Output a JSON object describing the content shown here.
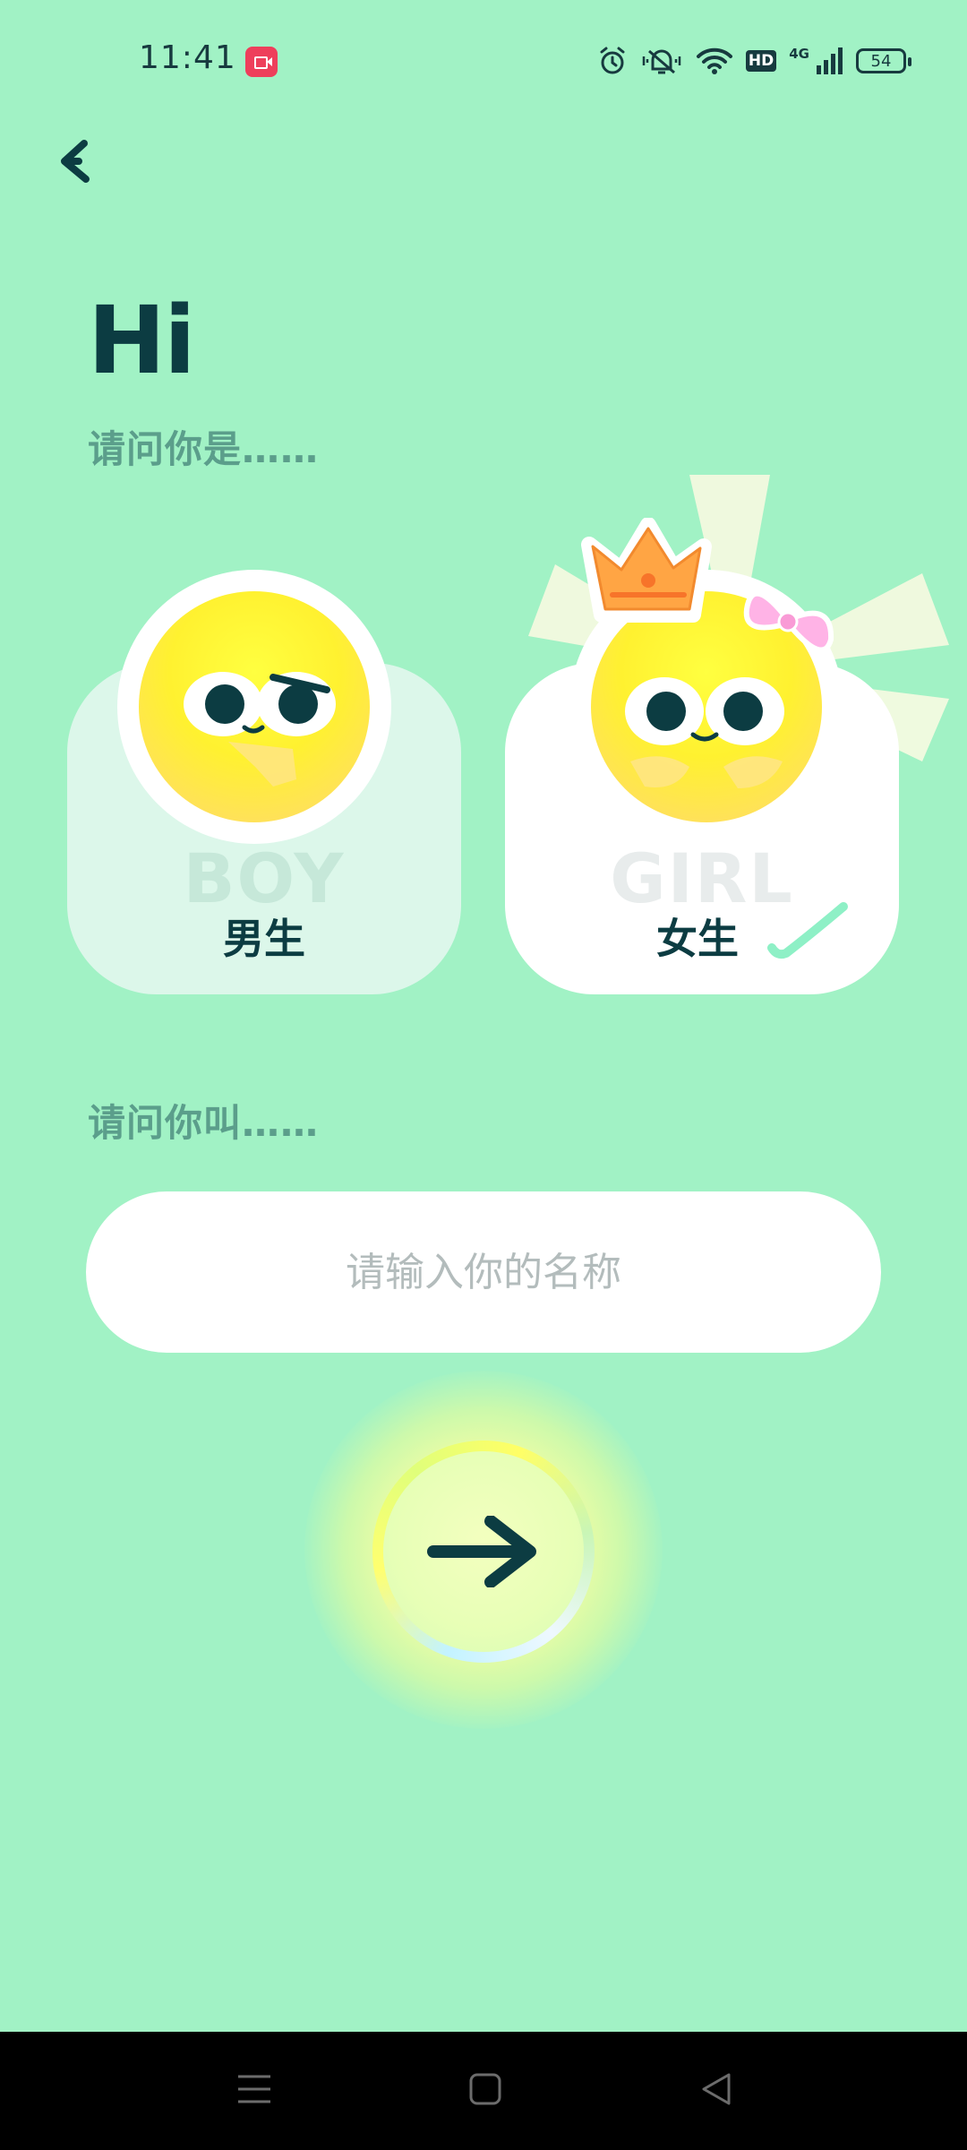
{
  "status_bar": {
    "time": "11:41",
    "icons": [
      "screen-record-icon",
      "alarm-icon",
      "mute-icon",
      "wifi-icon",
      "hd-icon",
      "signal-4g-icon",
      "battery-icon"
    ],
    "hd_label": "HD",
    "network_label": "4G",
    "battery_level": "54"
  },
  "header": {
    "back_icon": "back-icon",
    "title": "Hi",
    "gender_question": "请问你是……"
  },
  "gender_options": [
    {
      "english": "BOY",
      "label": "男生",
      "selected": false
    },
    {
      "english": "GIRL",
      "label": "女生",
      "selected": true
    }
  ],
  "name_section": {
    "question": "请问你叫……",
    "input_value": "",
    "input_placeholder": "请输入你的名称"
  },
  "next_button": {
    "icon": "arrow-right-icon"
  },
  "nav_bar": {
    "icons": [
      "menu-icon",
      "home-icon",
      "back-triangle-icon"
    ]
  },
  "colors": {
    "background": "#a1f2c5",
    "primary_text": "#0c3c42",
    "secondary_text": "#5b9e8b",
    "selected_card": "#ffffff",
    "unselected_card": "#dcf7ea",
    "check": "#8ef0c6",
    "record_badge": "#ee3f5b"
  }
}
